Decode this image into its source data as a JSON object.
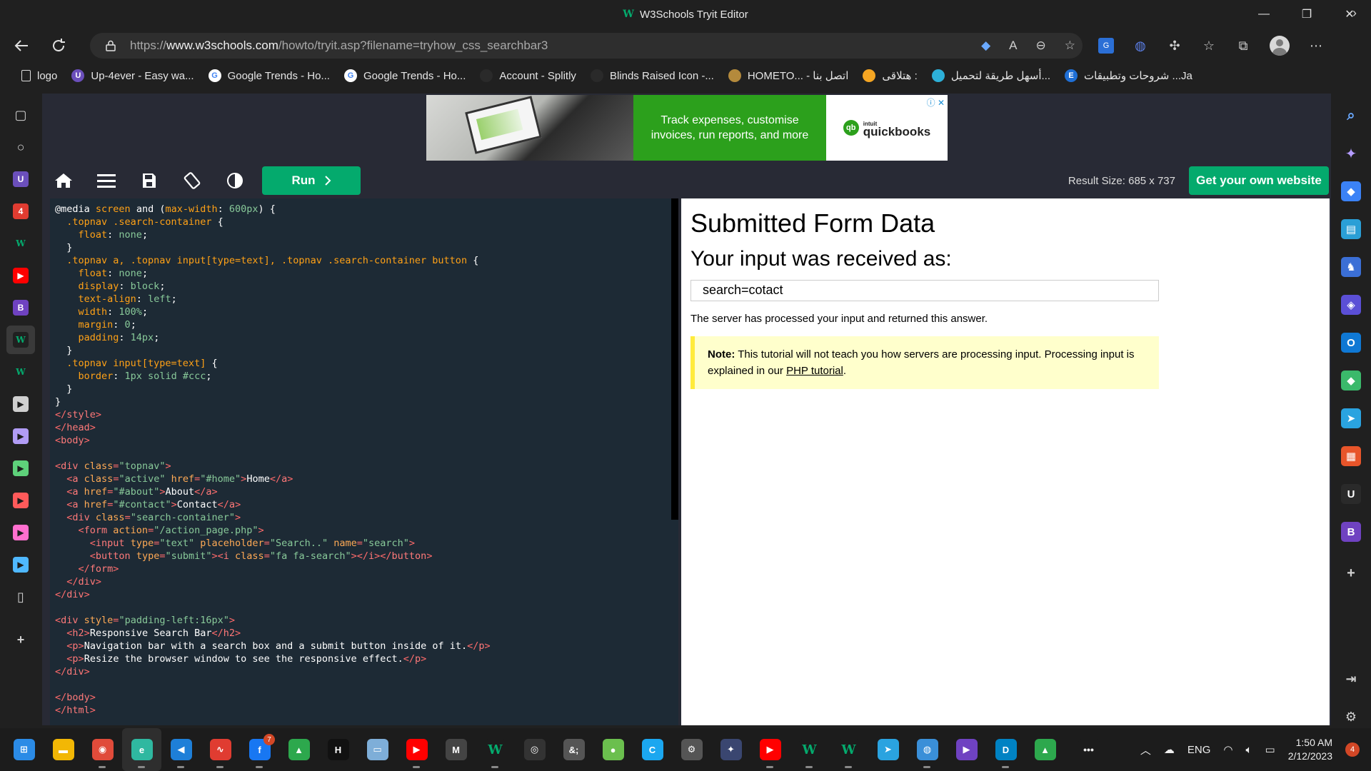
{
  "window": {
    "title": "W3Schools Tryit Editor",
    "w3_mark": "W",
    "controls": [
      "—",
      "❐",
      "✕"
    ]
  },
  "address": {
    "url_prefix": "https://",
    "url_host": "www.w3schools.com",
    "url_path": "/howto/tryit.asp?filename=tryhow_css_searchbar3"
  },
  "bookmarks": [
    {
      "label": "logo",
      "icon": "document-icon",
      "color": "#444444",
      "glyph": ""
    },
    {
      "label": "Up-4ever - Easy wa...",
      "icon": "up4ever-icon",
      "color": "#6b4fbb",
      "glyph": "U"
    },
    {
      "label": "Google Trends - Ho...",
      "icon": "google-icon",
      "color": "#ffffff",
      "glyph": "G"
    },
    {
      "label": "Google Trends - Ho...",
      "icon": "google-icon",
      "color": "#ffffff",
      "glyph": "G"
    },
    {
      "label": "Account - Splitly",
      "icon": "splitly-icon",
      "color": "#2a2a2a",
      "glyph": ""
    },
    {
      "label": "Blinds Raised Icon -...",
      "icon": "flag-icon",
      "color": "#2a2a2a",
      "glyph": ""
    },
    {
      "label": "HOMETO... - اتصل بنا",
      "icon": "hometo-icon",
      "color": "#b48a3c",
      "glyph": ""
    },
    {
      "label": "هتلاقى :",
      "icon": "smiley-icon",
      "color": "#f5a623",
      "glyph": ""
    },
    {
      "label": "أسهل طريقة لتحميل...",
      "icon": "site-icon",
      "color": "#2db0d8",
      "glyph": ""
    },
    {
      "label": "شروحات وتطبيقات ...Ja",
      "icon": "e-icon",
      "color": "#1f6fd6",
      "glyph": "E"
    }
  ],
  "ad": {
    "text": "Track expenses, customise invoices, run reports, and more",
    "brand_small": "intuit",
    "brand": "quickbooks",
    "logo_glyph": "qb"
  },
  "toolbar": {
    "run_label": "Run",
    "result_size": "Result Size: 685 x 737",
    "get_site_label": "Get your own website"
  },
  "code_lines": [
    [
      [
        "kw",
        "@media "
      ],
      [
        "sel",
        "screen "
      ],
      [
        "kw",
        "and "
      ],
      [
        "kw",
        "("
      ],
      [
        "sel",
        "max-width"
      ],
      [
        "kw",
        ": "
      ],
      [
        "val",
        "600px"
      ],
      [
        "kw",
        ") {"
      ]
    ],
    [
      [
        "sel",
        "  .topnav .search-container "
      ],
      [
        "kw",
        "{"
      ]
    ],
    [
      [
        "sel",
        "    float"
      ],
      [
        "kw",
        ": "
      ],
      [
        "val",
        "none"
      ],
      [
        "kw",
        ";"
      ]
    ],
    [
      [
        "kw",
        "  }"
      ]
    ],
    [
      [
        "sel",
        "  .topnav a, .topnav input[type=text], .topnav .search-container button "
      ],
      [
        "kw",
        "{"
      ]
    ],
    [
      [
        "sel",
        "    float"
      ],
      [
        "kw",
        ": "
      ],
      [
        "val",
        "none"
      ],
      [
        "kw",
        ";"
      ]
    ],
    [
      [
        "sel",
        "    display"
      ],
      [
        "kw",
        ": "
      ],
      [
        "val",
        "block"
      ],
      [
        "kw",
        ";"
      ]
    ],
    [
      [
        "sel",
        "    text-align"
      ],
      [
        "kw",
        ": "
      ],
      [
        "val",
        "left"
      ],
      [
        "kw",
        ";"
      ]
    ],
    [
      [
        "sel",
        "    width"
      ],
      [
        "kw",
        ": "
      ],
      [
        "val",
        "100%"
      ],
      [
        "kw",
        ";"
      ]
    ],
    [
      [
        "sel",
        "    margin"
      ],
      [
        "kw",
        ": "
      ],
      [
        "val",
        "0"
      ],
      [
        "kw",
        ";"
      ]
    ],
    [
      [
        "sel",
        "    padding"
      ],
      [
        "kw",
        ": "
      ],
      [
        "val",
        "14px"
      ],
      [
        "kw",
        ";"
      ]
    ],
    [
      [
        "kw",
        "  }"
      ]
    ],
    [
      [
        "sel",
        "  .topnav input[type=text] "
      ],
      [
        "kw",
        "{"
      ]
    ],
    [
      [
        "sel",
        "    border"
      ],
      [
        "kw",
        ": "
      ],
      [
        "val",
        "1px solid #ccc"
      ],
      [
        "kw",
        ";"
      ]
    ],
    [
      [
        "kw",
        "  }"
      ]
    ],
    [
      [
        "kw",
        "}"
      ]
    ],
    [
      [
        "tag",
        "</"
      ],
      [
        "tagn",
        "style"
      ],
      [
        "tag",
        ">"
      ]
    ],
    [
      [
        "tag",
        "</"
      ],
      [
        "tagn",
        "head"
      ],
      [
        "tag",
        ">"
      ]
    ],
    [
      [
        "tag",
        "<"
      ],
      [
        "tagn",
        "body"
      ],
      [
        "tag",
        ">"
      ]
    ],
    [
      [
        "txt",
        ""
      ]
    ],
    [
      [
        "tag",
        "<"
      ],
      [
        "tagn",
        "div "
      ],
      [
        "attr",
        "class"
      ],
      [
        "tag",
        "="
      ],
      [
        "str",
        "\"topnav\""
      ],
      [
        "tag",
        ">"
      ]
    ],
    [
      [
        "txt",
        "  "
      ],
      [
        "tag",
        "<"
      ],
      [
        "tagn",
        "a "
      ],
      [
        "attr",
        "class"
      ],
      [
        "tag",
        "="
      ],
      [
        "str",
        "\"active\" "
      ],
      [
        "attr",
        "href"
      ],
      [
        "tag",
        "="
      ],
      [
        "str",
        "\"#home\""
      ],
      [
        "tag",
        ">"
      ],
      [
        "txt",
        "Home"
      ],
      [
        "tag",
        "</"
      ],
      [
        "tagn",
        "a"
      ],
      [
        "tag",
        ">"
      ]
    ],
    [
      [
        "txt",
        "  "
      ],
      [
        "tag",
        "<"
      ],
      [
        "tagn",
        "a "
      ],
      [
        "attr",
        "href"
      ],
      [
        "tag",
        "="
      ],
      [
        "str",
        "\"#about\""
      ],
      [
        "tag",
        ">"
      ],
      [
        "txt",
        "About"
      ],
      [
        "tag",
        "</"
      ],
      [
        "tagn",
        "a"
      ],
      [
        "tag",
        ">"
      ]
    ],
    [
      [
        "txt",
        "  "
      ],
      [
        "tag",
        "<"
      ],
      [
        "tagn",
        "a "
      ],
      [
        "attr",
        "href"
      ],
      [
        "tag",
        "="
      ],
      [
        "str",
        "\"#contact\""
      ],
      [
        "tag",
        ">"
      ],
      [
        "txt",
        "Contact"
      ],
      [
        "tag",
        "</"
      ],
      [
        "tagn",
        "a"
      ],
      [
        "tag",
        ">"
      ]
    ],
    [
      [
        "txt",
        "  "
      ],
      [
        "tag",
        "<"
      ],
      [
        "tagn",
        "div "
      ],
      [
        "attr",
        "class"
      ],
      [
        "tag",
        "="
      ],
      [
        "str",
        "\"search-container\""
      ],
      [
        "tag",
        ">"
      ]
    ],
    [
      [
        "txt",
        "    "
      ],
      [
        "tag",
        "<"
      ],
      [
        "tagn",
        "form "
      ],
      [
        "attr",
        "action"
      ],
      [
        "tag",
        "="
      ],
      [
        "str",
        "\"/action_page.php\""
      ],
      [
        "tag",
        ">"
      ]
    ],
    [
      [
        "txt",
        "      "
      ],
      [
        "tag",
        "<"
      ],
      [
        "tagn",
        "input "
      ],
      [
        "attr",
        "type"
      ],
      [
        "tag",
        "="
      ],
      [
        "str",
        "\"text\" "
      ],
      [
        "attr",
        "placeholder"
      ],
      [
        "tag",
        "="
      ],
      [
        "str",
        "\"Search..\" "
      ],
      [
        "attr",
        "name"
      ],
      [
        "tag",
        "="
      ],
      [
        "str",
        "\"search\""
      ],
      [
        "tag",
        ">"
      ]
    ],
    [
      [
        "txt",
        "      "
      ],
      [
        "tag",
        "<"
      ],
      [
        "tagn",
        "button "
      ],
      [
        "attr",
        "type"
      ],
      [
        "tag",
        "="
      ],
      [
        "str",
        "\"submit\""
      ],
      [
        "tag",
        "><"
      ],
      [
        "tagn",
        "i "
      ],
      [
        "attr",
        "class"
      ],
      [
        "tag",
        "="
      ],
      [
        "str",
        "\"fa fa-search\""
      ],
      [
        "tag",
        "></"
      ],
      [
        "tagn",
        "i"
      ],
      [
        "tag",
        "></"
      ],
      [
        "tagn",
        "button"
      ],
      [
        "tag",
        ">"
      ]
    ],
    [
      [
        "txt",
        "    "
      ],
      [
        "tag",
        "</"
      ],
      [
        "tagn",
        "form"
      ],
      [
        "tag",
        ">"
      ]
    ],
    [
      [
        "txt",
        "  "
      ],
      [
        "tag",
        "</"
      ],
      [
        "tagn",
        "div"
      ],
      [
        "tag",
        ">"
      ]
    ],
    [
      [
        "tag",
        "</"
      ],
      [
        "tagn",
        "div"
      ],
      [
        "tag",
        ">"
      ]
    ],
    [
      [
        "txt",
        ""
      ]
    ],
    [
      [
        "tag",
        "<"
      ],
      [
        "tagn",
        "div "
      ],
      [
        "attr",
        "style"
      ],
      [
        "tag",
        "="
      ],
      [
        "str",
        "\"padding-left:16px\""
      ],
      [
        "tag",
        ">"
      ]
    ],
    [
      [
        "txt",
        "  "
      ],
      [
        "tag",
        "<"
      ],
      [
        "tagn",
        "h2"
      ],
      [
        "tag",
        ">"
      ],
      [
        "txt",
        "Responsive Search Bar"
      ],
      [
        "tag",
        "</"
      ],
      [
        "tagn",
        "h2"
      ],
      [
        "tag",
        ">"
      ]
    ],
    [
      [
        "txt",
        "  "
      ],
      [
        "tag",
        "<"
      ],
      [
        "tagn",
        "p"
      ],
      [
        "tag",
        ">"
      ],
      [
        "txt",
        "Navigation bar with a search box and a submit button inside of it."
      ],
      [
        "tag",
        "</"
      ],
      [
        "tagn",
        "p"
      ],
      [
        "tag",
        ">"
      ]
    ],
    [
      [
        "txt",
        "  "
      ],
      [
        "tag",
        "<"
      ],
      [
        "tagn",
        "p"
      ],
      [
        "tag",
        ">"
      ],
      [
        "txt",
        "Resize the browser window to see the responsive effect."
      ],
      [
        "tag",
        "</"
      ],
      [
        "tagn",
        "p"
      ],
      [
        "tag",
        ">"
      ]
    ],
    [
      [
        "tag",
        "</"
      ],
      [
        "tagn",
        "div"
      ],
      [
        "tag",
        ">"
      ]
    ],
    [
      [
        "txt",
        ""
      ]
    ],
    [
      [
        "tag",
        "</"
      ],
      [
        "tagn",
        "body"
      ],
      [
        "tag",
        ">"
      ]
    ],
    [
      [
        "tag",
        "</"
      ],
      [
        "tagn",
        "html"
      ],
      [
        "tag",
        ">"
      ]
    ]
  ],
  "result": {
    "heading": "Submitted Form Data",
    "subheading": "Your input was received as:",
    "value": "search=cotact",
    "processed": "The server has processed your input and returned this answer.",
    "note_bold": "Note:",
    "note_text": " This tutorial will not teach you how servers are processing input. Processing input is explained in our ",
    "note_link": "PHP tutorial",
    "note_end": "."
  },
  "left_sidebar": [
    {
      "name": "tab-actions-icon",
      "glyph": "▢",
      "color": "#2a2a2a"
    },
    {
      "name": "search-icon",
      "glyph": "○",
      "color": "#2a2a2a"
    },
    {
      "name": "up4ever-icon",
      "glyph": "U",
      "color": "#6b4fbb"
    },
    {
      "name": "adobe-icon",
      "glyph": "4",
      "color": "#e03c31"
    },
    {
      "name": "w3schools-icon",
      "glyph": "W",
      "color": "#202020"
    },
    {
      "name": "youtube-icon",
      "glyph": "▶",
      "color": "#ff0000"
    },
    {
      "name": "b-icon",
      "glyph": "B",
      "color": "#6f42c1"
    },
    {
      "name": "w3schools-active-icon",
      "glyph": "W",
      "color": "#202020"
    },
    {
      "name": "w3schools-icon-2",
      "glyph": "W",
      "color": "#202020"
    },
    {
      "name": "video-icon-1",
      "glyph": "▶",
      "color": "#cfcfcf"
    },
    {
      "name": "video-icon-2",
      "glyph": "▶",
      "color": "#b19cf5"
    },
    {
      "name": "video-icon-3",
      "glyph": "▶",
      "color": "#5ed17a"
    },
    {
      "name": "video-icon-4",
      "glyph": "▶",
      "color": "#ff5a5a"
    },
    {
      "name": "video-icon-5",
      "glyph": "▶",
      "color": "#ff6fcf"
    },
    {
      "name": "video-icon-6",
      "glyph": "▶",
      "color": "#4fb8ff"
    },
    {
      "name": "page-icon",
      "glyph": "▯",
      "color": "#2a2a2a"
    },
    {
      "name": "add-icon",
      "glyph": "+",
      "color": "#2a2a2a"
    }
  ],
  "right_sidebar": [
    {
      "name": "search-icon",
      "glyph": "⌕",
      "color": "#202020"
    },
    {
      "name": "sparkle-icon",
      "glyph": "✦",
      "color": "#202020"
    },
    {
      "name": "tag-icon",
      "glyph": "◆",
      "color": "#3b82f6"
    },
    {
      "name": "toolbox-icon",
      "glyph": "▤",
      "color": "#2a9fd6"
    },
    {
      "name": "games-icon",
      "glyph": "♞",
      "color": "#3b6fd6"
    },
    {
      "name": "copilot-icon",
      "glyph": "◈",
      "color": "#5b4fd6"
    },
    {
      "name": "outlook-icon",
      "glyph": "O",
      "color": "#0f78d4"
    },
    {
      "name": "drop-icon",
      "glyph": "◆",
      "color": "#3bb96b"
    },
    {
      "name": "telegram-icon",
      "glyph": "➤",
      "color": "#2aa3e0"
    },
    {
      "name": "office-icon",
      "glyph": "▦",
      "color": "#e8552a"
    },
    {
      "name": "u-icon",
      "glyph": "U",
      "color": "#2a2a2a"
    },
    {
      "name": "b-icon",
      "glyph": "B",
      "color": "#6f42c1"
    },
    {
      "name": "add-icon",
      "glyph": "+",
      "color": "#202020"
    }
  ],
  "taskbar_apps": [
    {
      "name": "start-icon",
      "glyph": "⊞",
      "color": "#2b8be6"
    },
    {
      "name": "file-explorer-icon",
      "glyph": "▬",
      "color": "#f2b705"
    },
    {
      "name": "chrome-icon",
      "glyph": "◉",
      "color": "#e04b3a"
    },
    {
      "name": "edge-icon",
      "glyph": "e",
      "color": "#2fb8a0"
    },
    {
      "name": "vscode-icon",
      "glyph": "◀",
      "color": "#1e7fd8"
    },
    {
      "name": "pdf-icon",
      "glyph": "∿",
      "color": "#e03c31"
    },
    {
      "name": "facebook-icon",
      "glyph": "f",
      "color": "#1877f2"
    },
    {
      "name": "drive-icon",
      "glyph": "▲",
      "color": "#2da84d"
    },
    {
      "name": "hostinger-icon",
      "glyph": "H",
      "color": "#111111"
    },
    {
      "name": "image-icon",
      "glyph": "▭",
      "color": "#7eaed8"
    },
    {
      "name": "youtube-icon",
      "glyph": "▶",
      "color": "#ff0000"
    },
    {
      "name": "m-icon",
      "glyph": "M",
      "color": "#444444"
    },
    {
      "name": "w3schools-icon",
      "glyph": "W",
      "color": "#1c1c1c"
    },
    {
      "name": "obs-icon",
      "glyph": "◎",
      "color": "#333333"
    },
    {
      "name": "entity-icon",
      "glyph": "&;",
      "color": "#555555"
    },
    {
      "name": "leaf-icon",
      "glyph": "●",
      "color": "#6bbf4e"
    },
    {
      "name": "c-icon",
      "glyph": "C",
      "color": "#1ba7f0"
    },
    {
      "name": "settings-icon",
      "glyph": "⚙",
      "color": "#555555"
    },
    {
      "name": "app-icon",
      "glyph": "✦",
      "color": "#3a4670"
    },
    {
      "name": "youtube-icon-2",
      "glyph": "▶",
      "color": "#ff0000"
    },
    {
      "name": "w3schools-icon-2",
      "glyph": "W",
      "color": "#1c1c1c"
    },
    {
      "name": "w3schools-icon-3",
      "glyph": "W",
      "color": "#1c1c1c"
    },
    {
      "name": "telegram-icon",
      "glyph": "➤",
      "color": "#2aa3e0"
    },
    {
      "name": "globe-icon",
      "glyph": "◍",
      "color": "#3a8fd8"
    },
    {
      "name": "player-icon",
      "glyph": "▶",
      "color": "#6f42c1"
    },
    {
      "name": "decathlon-icon",
      "glyph": "D",
      "color": "#0082c3"
    },
    {
      "name": "drive-icon-2",
      "glyph": "▲",
      "color": "#2da84d"
    },
    {
      "name": "more-icon",
      "glyph": "•••",
      "color": "#1c1c1c"
    }
  ],
  "tray": {
    "lang": "ENG",
    "time": "1:50 AM",
    "date": "2/12/2023",
    "notifications": "4",
    "badge_fb": "7"
  }
}
